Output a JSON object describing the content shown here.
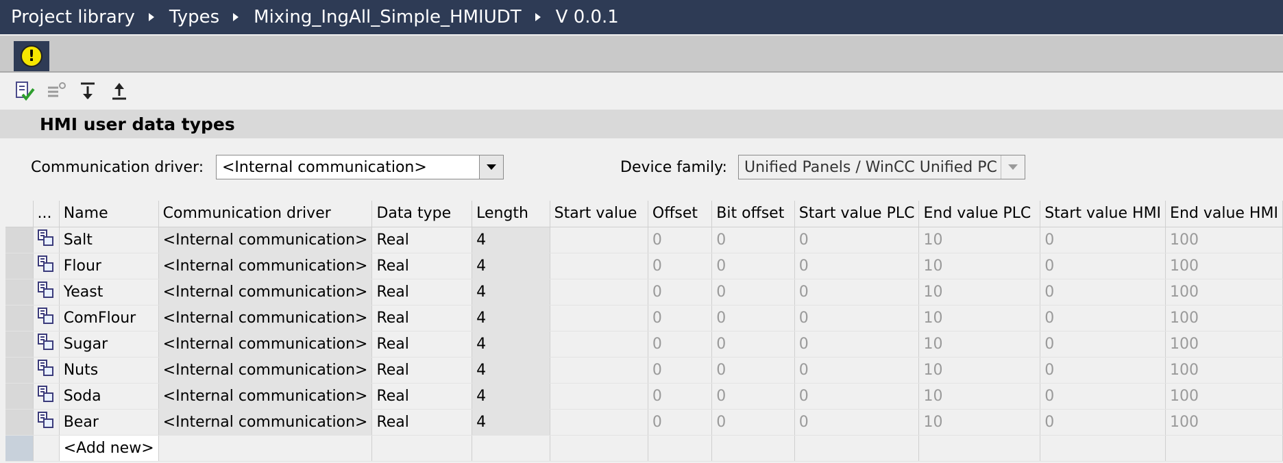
{
  "breadcrumb": [
    "Project library",
    "Types",
    "Mixing_IngAll_Simple_HMIUDT",
    "V 0.0.1"
  ],
  "alert_icon": "warning-icon",
  "toolbar": {
    "icons": [
      "consistency-check-icon",
      "generate-icon",
      "import-icon",
      "export-icon"
    ]
  },
  "section_title": "HMI user data types",
  "filters": {
    "comm_driver_label": "Communication driver:",
    "comm_driver_value": "<Internal communication>",
    "device_family_label": "Device family:",
    "device_family_value": "Unified Panels / WinCC Unified PC"
  },
  "table": {
    "columns": [
      "...",
      "Name",
      "Communication driver",
      "Data type",
      "Length",
      "Start value",
      "Offset",
      "Bit offset",
      "Start value PLC",
      "End value PLC",
      "Start value HMI",
      "End value HMI"
    ],
    "rows": [
      {
        "name": "Salt",
        "comm": "<Internal communication>",
        "dtype": "Real",
        "length": "4",
        "start": "",
        "offset": "0",
        "bitoffset": "0",
        "svplc": "0",
        "evplc": "10",
        "svhmi": "0",
        "evhmi": "100"
      },
      {
        "name": "Flour",
        "comm": "<Internal communication>",
        "dtype": "Real",
        "length": "4",
        "start": "",
        "offset": "0",
        "bitoffset": "0",
        "svplc": "0",
        "evplc": "10",
        "svhmi": "0",
        "evhmi": "100"
      },
      {
        "name": "Yeast",
        "comm": "<Internal communication>",
        "dtype": "Real",
        "length": "4",
        "start": "",
        "offset": "0",
        "bitoffset": "0",
        "svplc": "0",
        "evplc": "10",
        "svhmi": "0",
        "evhmi": "100"
      },
      {
        "name": "ComFlour",
        "comm": "<Internal communication>",
        "dtype": "Real",
        "length": "4",
        "start": "",
        "offset": "0",
        "bitoffset": "0",
        "svplc": "0",
        "evplc": "10",
        "svhmi": "0",
        "evhmi": "100"
      },
      {
        "name": "Sugar",
        "comm": "<Internal communication>",
        "dtype": "Real",
        "length": "4",
        "start": "",
        "offset": "0",
        "bitoffset": "0",
        "svplc": "0",
        "evplc": "10",
        "svhmi": "0",
        "evhmi": "100"
      },
      {
        "name": "Nuts",
        "comm": "<Internal communication>",
        "dtype": "Real",
        "length": "4",
        "start": "",
        "offset": "0",
        "bitoffset": "0",
        "svplc": "0",
        "evplc": "10",
        "svhmi": "0",
        "evhmi": "100"
      },
      {
        "name": "Soda",
        "comm": "<Internal communication>",
        "dtype": "Real",
        "length": "4",
        "start": "",
        "offset": "0",
        "bitoffset": "0",
        "svplc": "0",
        "evplc": "10",
        "svhmi": "0",
        "evhmi": "100"
      },
      {
        "name": "Bear",
        "comm": "<Internal communication>",
        "dtype": "Real",
        "length": "4",
        "start": "",
        "offset": "0",
        "bitoffset": "0",
        "svplc": "0",
        "evplc": "10",
        "svhmi": "0",
        "evhmi": "100"
      }
    ],
    "add_new": "<Add new>"
  },
  "colors": {
    "titlebar": "#2e3b55",
    "warning": "#f6e600",
    "grey_text": "#9a9a9a"
  }
}
